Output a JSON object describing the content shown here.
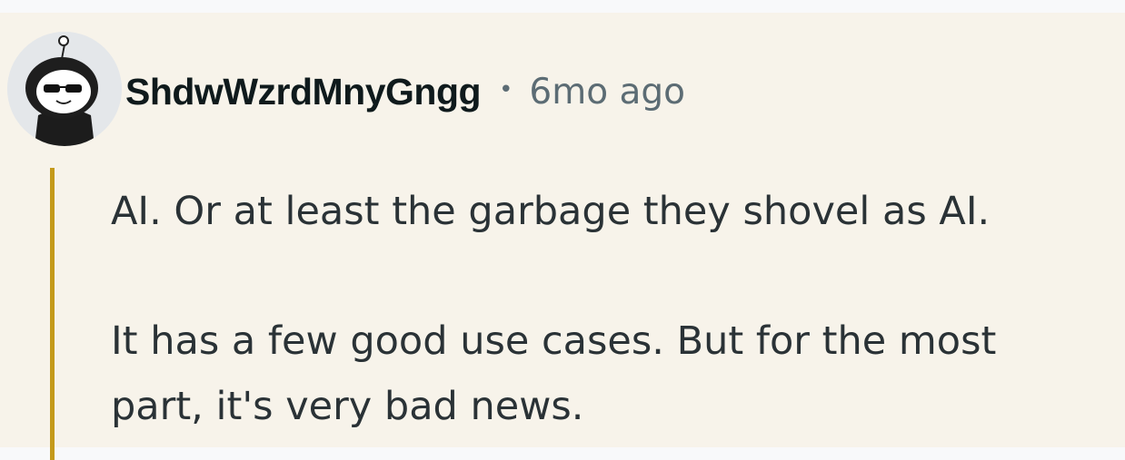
{
  "comment": {
    "author": "ShdwWzrdMnyGngg",
    "separator": "•",
    "timestamp": "6mo ago",
    "avatar_icon": "snoo-avatar-sunglasses-icon",
    "thread_line_color": "#c49a1b",
    "paragraphs": [
      {
        "lines": [
          "AI. Or at least the garbage they shovel as AI."
        ]
      },
      {
        "lines": [
          "It has a few good use cases. But for the most",
          "part, it's very bad news."
        ]
      }
    ]
  }
}
